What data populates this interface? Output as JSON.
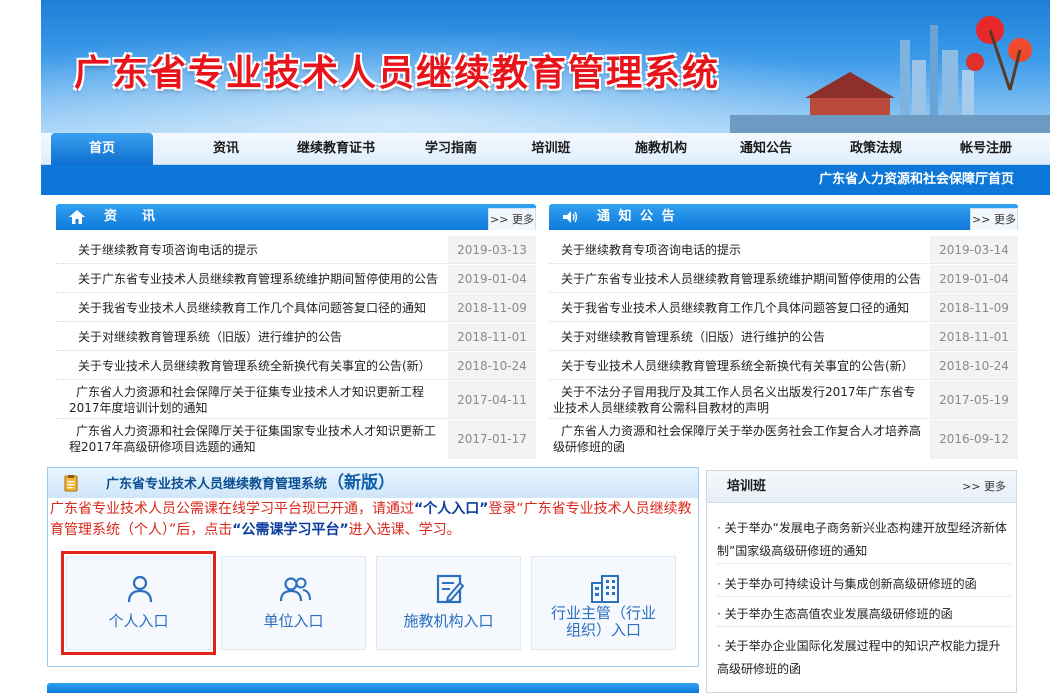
{
  "banner": {
    "title": "广东省专业技术人员继续教育管理系统"
  },
  "nav": {
    "items": [
      {
        "label": "首页",
        "active": true
      },
      {
        "label": "资讯"
      },
      {
        "label": "继续教育证书"
      },
      {
        "label": "学习指南"
      },
      {
        "label": "培训班"
      },
      {
        "label": "施教机构"
      },
      {
        "label": "通知公告"
      },
      {
        "label": "政策法规"
      },
      {
        "label": "帐号注册"
      }
    ]
  },
  "subbar": {
    "link": "广东省人力资源和社会保障厅首页"
  },
  "news": {
    "title": "资　讯",
    "more": ">> 更多",
    "items": [
      {
        "title": "关于继续教育专项咨询电话的提示",
        "date": "2019-03-13"
      },
      {
        "title": "关于广东省专业技术人员继续教育管理系统维护期间暂停使用的公告",
        "date": "2019-01-04"
      },
      {
        "title": "关于我省专业技术人员继续教育工作几个具体问题答复口径的通知",
        "date": "2018-11-09"
      },
      {
        "title": "关于对继续教育管理系统（旧版）进行维护的公告",
        "date": "2018-11-01"
      },
      {
        "title": "关于专业技术人员继续教育管理系统全新换代有关事宜的公告(新）",
        "date": "2018-10-24"
      },
      {
        "title": "广东省人力资源和社会保障厅关于征集专业技术人才知识更新工程2017年度培训计划的通知",
        "date": "2017-04-11"
      },
      {
        "title": "广东省人力资源和社会保障厅关于征集国家专业技术人才知识更新工程2017年高级研修项目选题的通知",
        "date": "2017-01-17"
      }
    ]
  },
  "notice": {
    "title": "通 知 公 告",
    "more": ">> 更多",
    "items": [
      {
        "title": "关于继续教育专项咨询电话的提示",
        "date": "2019-03-14"
      },
      {
        "title": "关于广东省专业技术人员继续教育管理系统维护期间暂停使用的公告",
        "date": "2019-01-04"
      },
      {
        "title": "关于我省专业技术人员继续教育工作几个具体问题答复口径的通知",
        "date": "2018-11-09"
      },
      {
        "title": "关于对继续教育管理系统（旧版）进行维护的公告",
        "date": "2018-11-01"
      },
      {
        "title": "关于专业技术人员继续教育管理系统全新换代有关事宜的公告(新）",
        "date": "2018-10-24"
      },
      {
        "title": "关于不法分子冒用我厅及其工作人员名义出版发行2017年广东省专业技术人员继续教育公需科目教材的声明",
        "date": "2017-05-19"
      },
      {
        "title": "广东省人力资源和社会保障厅关于举办医务社会工作复合人才培养高级研修班的函",
        "date": "2016-09-12"
      }
    ]
  },
  "system": {
    "title": "广东省专业技术人员继续教育管理系统",
    "version": "（新版）",
    "text_1": "广东省专业技术人员公需课在线学习平台现已开通，请通过",
    "text_q1": "“个人入口”",
    "text_2": "登录“广东省专业技术人员继续教育管理系统（个人）”后，点击",
    "text_q2": "“公需课学习平台”",
    "text_3": "进入选课、学习。",
    "entries": [
      {
        "label": "个人入口",
        "icon": "user-icon"
      },
      {
        "label": "单位入口",
        "icon": "users-icon"
      },
      {
        "label": "施教机构入口",
        "icon": "edit-document-icon"
      },
      {
        "label": "行业主管（行业组织）入口",
        "icon": "building-icon"
      }
    ]
  },
  "training": {
    "title": "培训班",
    "more": ">> 更多",
    "items": [
      "· 关于举办“发展电子商务新兴业态构建开放型经济新体制”国家级高级研修班的通知",
      "· 关于举办可持续设计与集成创新高级研修班的函",
      "· 关于举办生态高值农业发展高级研修班的函",
      "· 关于举办企业国际化发展过程中的知识产权能力提升高级研修班的函"
    ]
  },
  "colors": {
    "primary": "#0e79da",
    "title_red": "#e8141b",
    "highlight": "#e2231a"
  }
}
